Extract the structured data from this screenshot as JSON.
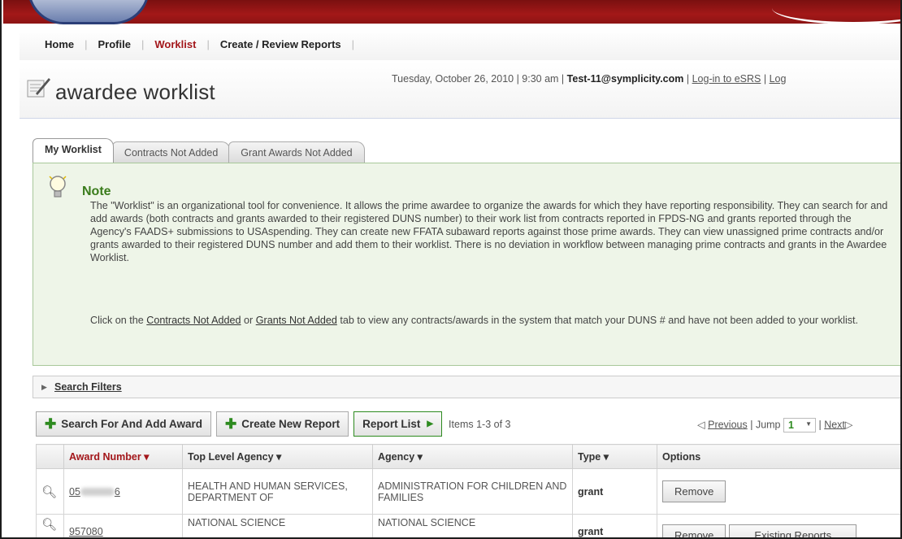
{
  "nav": {
    "items": [
      {
        "label": "Home",
        "active": false
      },
      {
        "label": "Profile",
        "active": false
      },
      {
        "label": "Worklist",
        "active": true
      },
      {
        "label": "Create / Review Reports",
        "active": false
      }
    ],
    "separator": "|"
  },
  "header": {
    "title": "awardee worklist",
    "date": "Tuesday, October 26, 2010 | 9:30 am | ",
    "user": "Test-11@symplicity.com",
    "sep": " | ",
    "link1": "Log-in to eSRS",
    "sep2": " | ",
    "link2": "Log"
  },
  "tabs": [
    {
      "label": "My Worklist",
      "active": true
    },
    {
      "label": "Contracts Not Added",
      "active": false
    },
    {
      "label": "Grant Awards Not Added",
      "active": false
    }
  ],
  "note": {
    "heading": "Note",
    "p1": "The \"Worklist\" is an organizational tool for convenience. It allows the prime awardee to organize the awards for which they have reporting responsibility. They can search for and add awards (both contracts and grants awarded to their registered DUNS number) to their work list from contracts reported in FPDS-NG and grants reported through the Agency's FAADS+ submissions to USAspending. They can create new FFATA subaward reports against those prime awards. They can view unassigned prime contracts and/or grants awarded to their registered DUNS number and add them to their worklist. There is no deviation in workflow between managing prime contracts and grants in the Awardee Worklist.",
    "p2_pre": "Click on the ",
    "p2_link1": "Contracts Not Added",
    "p2_mid": " or ",
    "p2_link2": "Grants Not Added",
    "p2_post": " tab to view any contracts/awards in the system that match your DUNS # and have not been added to your worklist."
  },
  "filters": {
    "label": "Search Filters"
  },
  "toolbar": {
    "search_add": "Search For And Add Award",
    "create_report": "Create New Report",
    "report_list": "Report List",
    "items": "Items 1-3 of 3"
  },
  "pager": {
    "previous": "Previous",
    "jump_label": " | Jump ",
    "jump_value": "1",
    "next": "Next",
    "sep": " | "
  },
  "table": {
    "columns": [
      "Award Number ▾",
      "Top Level Agency ▾",
      "Agency ▾",
      "Type ▾",
      "Options"
    ],
    "rows": [
      {
        "award_pre": "05",
        "award_post": "6",
        "top_agency": "HEALTH AND HUMAN SERVICES, DEPARTMENT OF",
        "agency": "ADMINISTRATION FOR CHILDREN AND FAMILIES",
        "type": "grant",
        "options": [
          "Remove"
        ]
      },
      {
        "award_pre": "957080",
        "award_post": "",
        "top_agency": "NATIONAL SCIENCE",
        "agency": "NATIONAL SCIENCE",
        "type": "grant",
        "options": [
          "Remove",
          "Existing Reports"
        ]
      }
    ]
  },
  "colors": {
    "accent_red": "#a3171b",
    "note_green": "#3a7c1c",
    "plus_green": "#2d8a1f"
  }
}
